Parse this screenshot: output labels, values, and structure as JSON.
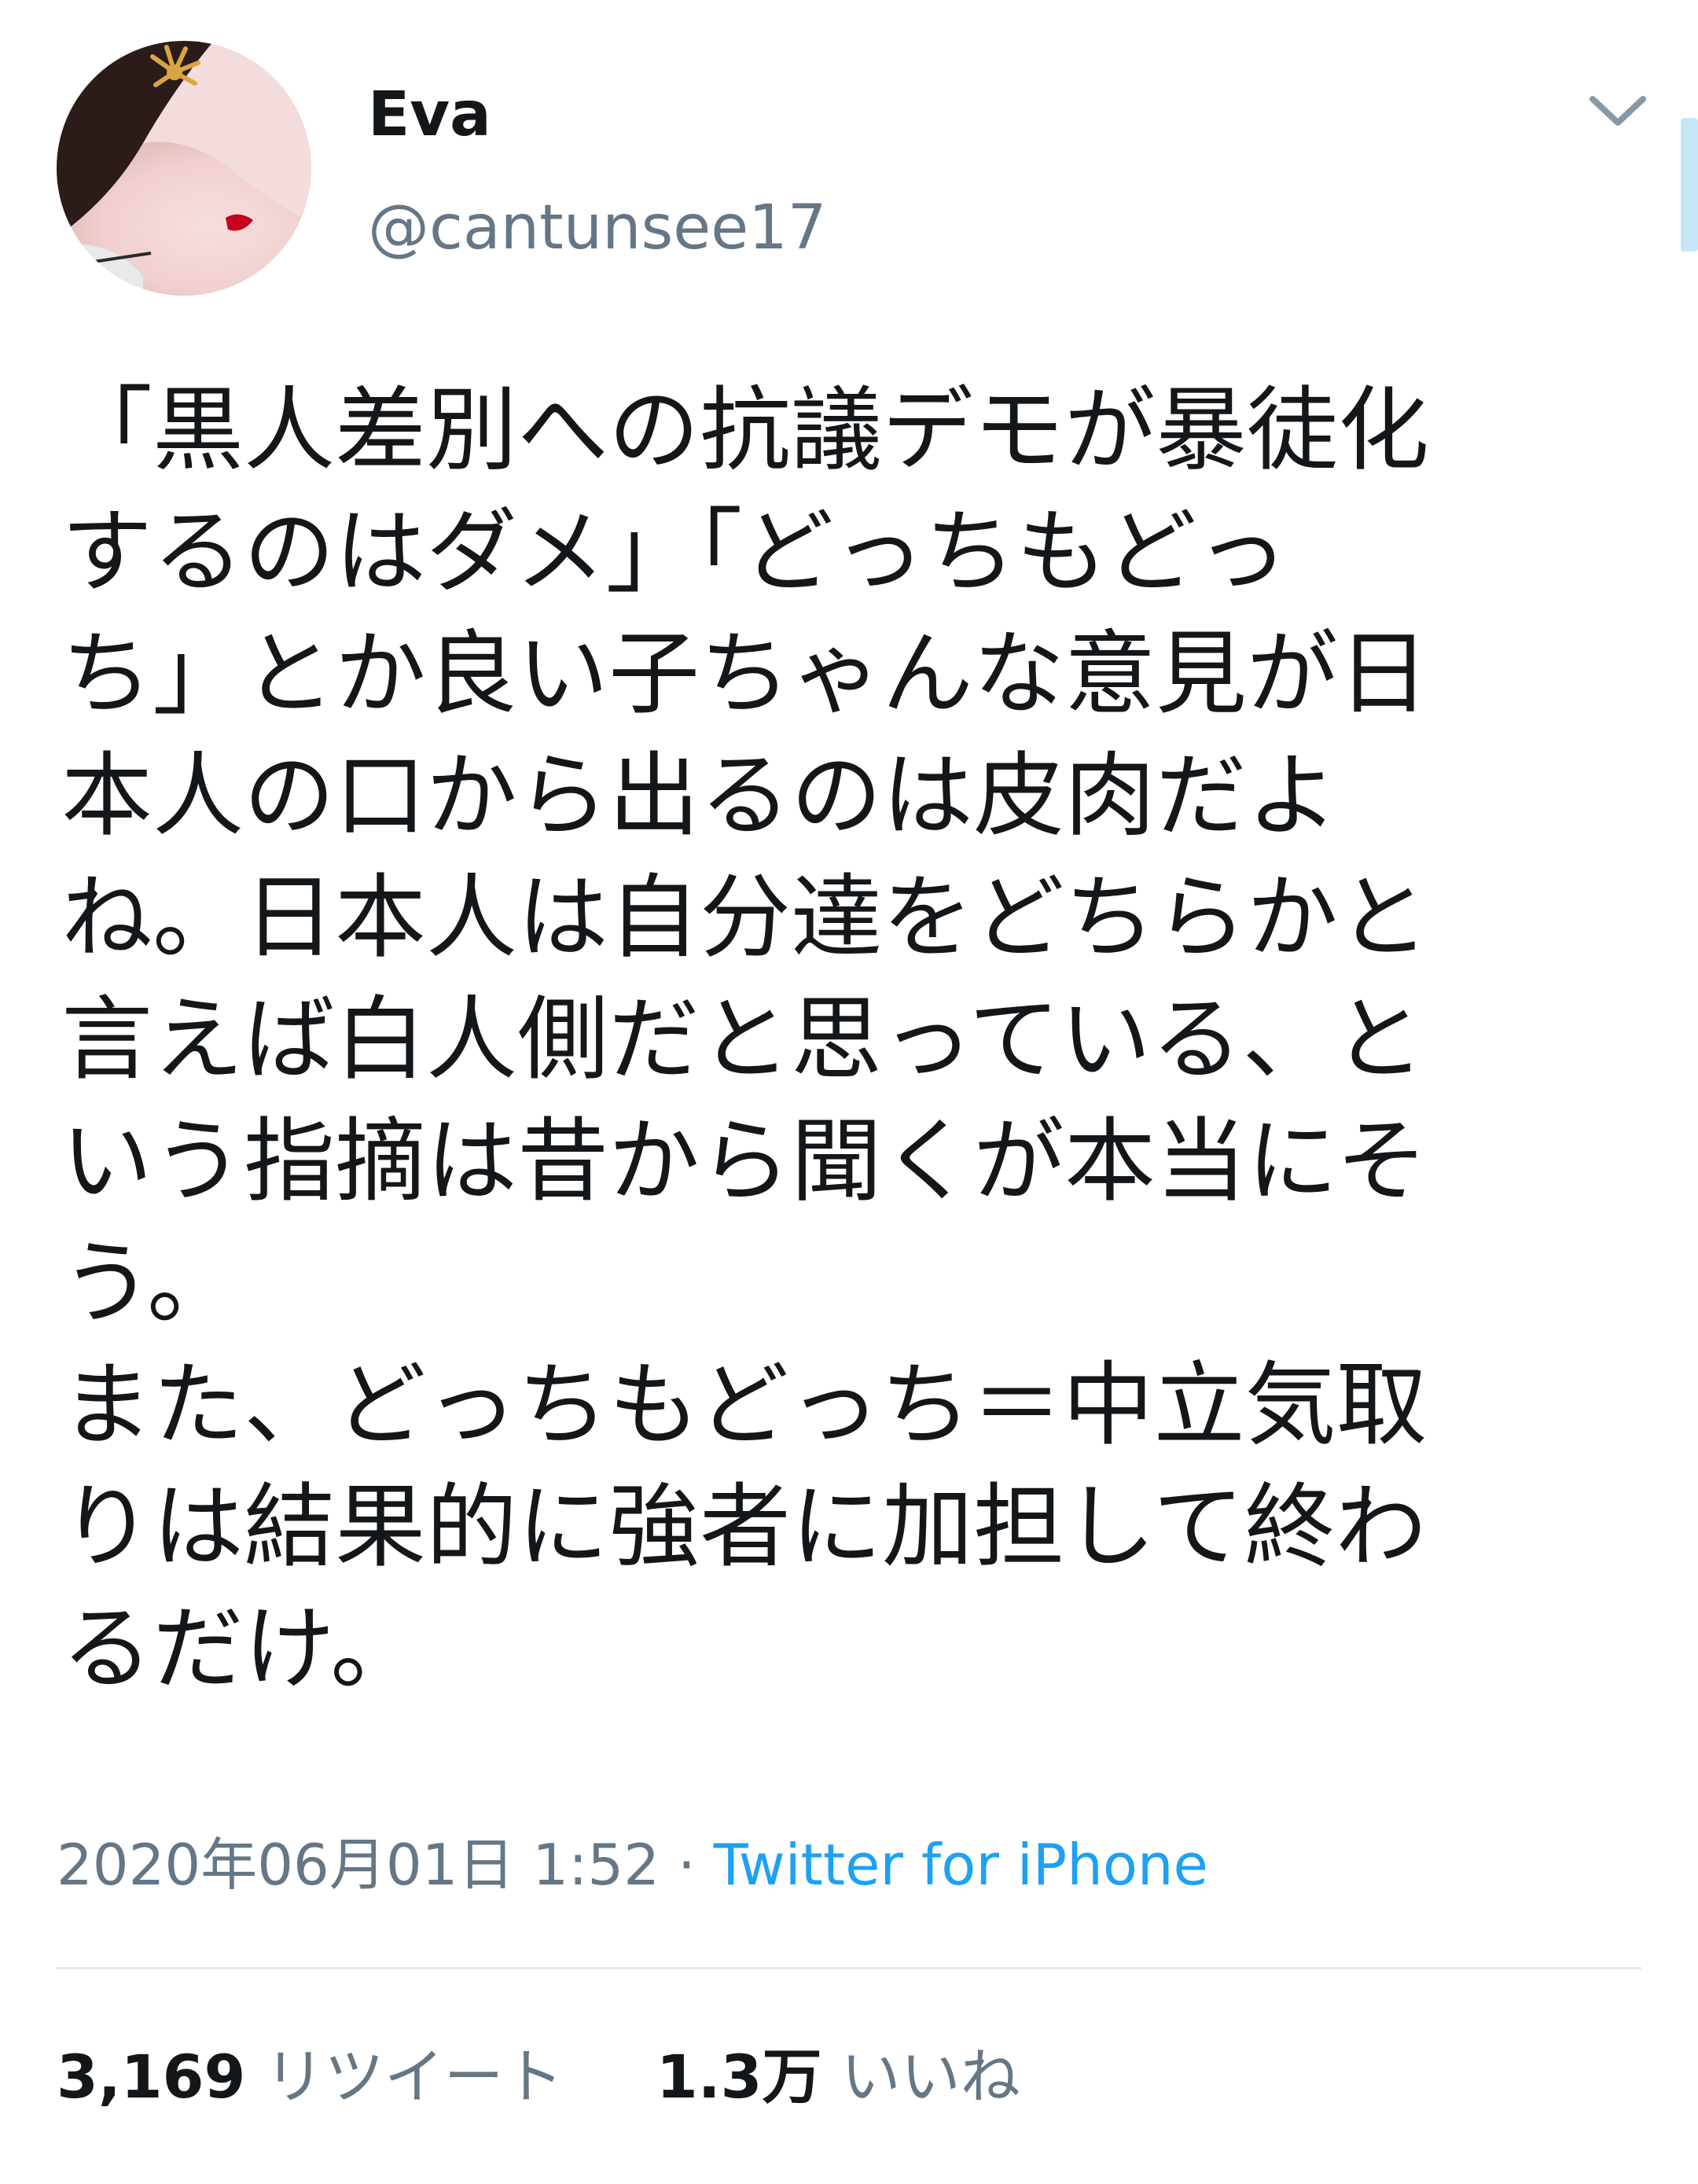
{
  "user": {
    "display_name": "Eva",
    "handle": "@cantunsee17",
    "avatar_icon": "profile-photo"
  },
  "tweet": {
    "lines": [
      " 「黒人差別への抗議デモが暴徒化",
      "するのはダメ」「どっちもどっ",
      "ち」とか良い子ちゃんな意見が日",
      "本人の口から出るのは皮肉だよ",
      "ね。日本人は自分達をどちらかと",
      "言えば白人側だと思っている、と",
      "いう指摘は昔から聞くが本当にそ",
      "う。",
      "また、どっちもどっち＝中立気取",
      "りは結果的に強者に加担して終わ",
      "るだけ。"
    ]
  },
  "meta": {
    "timestamp": "2020年06月01日 1:52",
    "separator": "·",
    "source": "Twitter for iPhone"
  },
  "stats": {
    "retweets_count": "3,169",
    "retweets_label": "リツイート",
    "likes_count": "1.3万",
    "likes_label": "いいね"
  },
  "colors": {
    "text": "#14171a",
    "secondary": "#657786",
    "link": "#1da1f2",
    "divider": "#e1e8ed"
  },
  "icons": {
    "more": "chevron-down-icon"
  }
}
